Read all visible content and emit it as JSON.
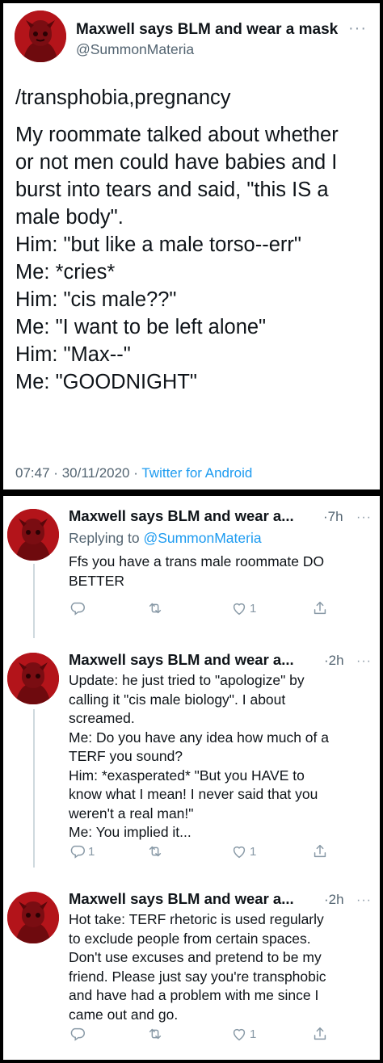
{
  "main_tweet": {
    "author_name": "Maxwell says BLM and wear a mask",
    "author_handle": "@SummonMateria",
    "more_icon": "more-dots-icon",
    "lines": [
      "/transphobia,pregnancy",
      "My roommate talked about whether",
      "or not men could have babies and I",
      "burst into tears and said, \"this IS a",
      "male body\".",
      "Him: \"but like a male torso--err\"",
      "Me: *cries*",
      "Him: \"cis male??\"",
      "Me: \"I want to be left alone\"",
      "Him: \"Max--\"",
      "Me: \"GOODNIGHT\""
    ],
    "time": "07:47",
    "date": "30/11/2020",
    "separator": "·",
    "source": "Twitter for Android"
  },
  "replies": [
    {
      "author_name": "Maxwell says BLM and wear a...",
      "time": "·7h",
      "replying_prefix": "Replying to",
      "replying_to": "@SummonMateria",
      "lines": [
        "Ffs you have a trans male roommate DO",
        "BETTER"
      ],
      "reply_count": "",
      "retweet_count": "",
      "like_count": "1"
    },
    {
      "author_name": "Maxwell says BLM and wear a...",
      "time": "·2h",
      "lines": [
        "Update: he just tried to \"apologize\" by",
        "calling it \"cis male biology\". I about",
        "screamed.",
        "Me: Do you have any idea how much of a",
        "TERF you sound?",
        "Him: *exasperated* \"But you HAVE to",
        "know what I mean! I never said that you",
        "weren't a real man!\"",
        "Me: You implied it..."
      ],
      "reply_count": "1",
      "retweet_count": "",
      "like_count": "1"
    },
    {
      "author_name": "Maxwell says BLM and wear a...",
      "time": "·2h",
      "lines": [
        "Hot take: TERF rhetoric is used regularly",
        "to exclude people from certain spaces.",
        "Don't use excuses and pretend to be my",
        "friend. Please just say you're transphobic",
        "and have had a problem with me since I",
        "came out and go."
      ],
      "reply_count": "",
      "retweet_count": "",
      "like_count": "1"
    }
  ],
  "icons": {
    "reply": "reply-icon",
    "retweet": "retweet-icon",
    "like": "heart-icon",
    "share": "share-icon"
  },
  "colors": {
    "link": "#1d9bf0",
    "secondary_text": "#536471",
    "avatar_bg": "#b3141a"
  }
}
